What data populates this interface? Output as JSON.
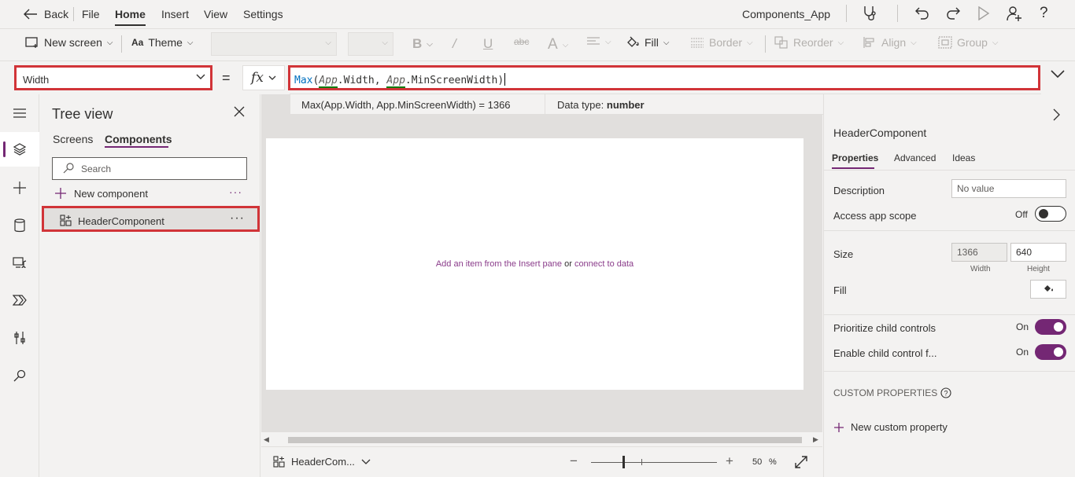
{
  "menubar": {
    "back_label": "Back",
    "items": [
      "File",
      "Home",
      "Insert",
      "View",
      "Settings"
    ],
    "active": "Home",
    "app_name": "Components_App"
  },
  "ribbon": {
    "new_screen": "New screen",
    "theme": "Theme",
    "fill": "Fill",
    "border": "Border",
    "reorder": "Reorder",
    "align": "Align",
    "group": "Group"
  },
  "formula": {
    "property": "Width",
    "equals": "=",
    "fx": "fx",
    "fn": "Max",
    "arg1_ref": "App",
    "arg1_prop": ".Width, ",
    "arg2_ref": "App",
    "arg2_prop": ".MinScreenWidth",
    "result_expr": "Max(App.Width, App.MinScreenWidth)  =  1366",
    "datatype_label": "Data type: ",
    "datatype_value": "number"
  },
  "tree": {
    "title": "Tree view",
    "tabs": [
      "Screens",
      "Components"
    ],
    "active_tab": "Components",
    "search_placeholder": "Search",
    "new_component": "New component",
    "more": "···",
    "items": [
      {
        "label": "HeaderComponent"
      }
    ]
  },
  "canvas": {
    "hint_link1": "Add an item from the Insert pane",
    "hint_or": " or ",
    "hint_link2": "connect to data",
    "screen_selector": "HeaderCom...",
    "zoom_minus": "−",
    "zoom_plus": "+",
    "zoom_value": "50",
    "zoom_unit": "%"
  },
  "properties": {
    "component_name": "HeaderComponent",
    "tabs": [
      "Properties",
      "Advanced",
      "Ideas"
    ],
    "active_tab": "Properties",
    "description_label": "Description",
    "description_placeholder": "No value",
    "access_scope_label": "Access app scope",
    "access_scope_state": "Off",
    "size_label": "Size",
    "width_value": "1366",
    "height_value": "640",
    "width_label": "Width",
    "height_label": "Height",
    "fill_label": "Fill",
    "prioritize_label": "Prioritize child controls",
    "prioritize_state": "On",
    "enable_label": "Enable child control f...",
    "enable_state": "On",
    "custom_header": "CUSTOM PROPERTIES",
    "new_custom": "New custom property"
  },
  "colors": {
    "accent": "#742774",
    "highlight_border": "#d13438",
    "function": "#0070c0"
  }
}
